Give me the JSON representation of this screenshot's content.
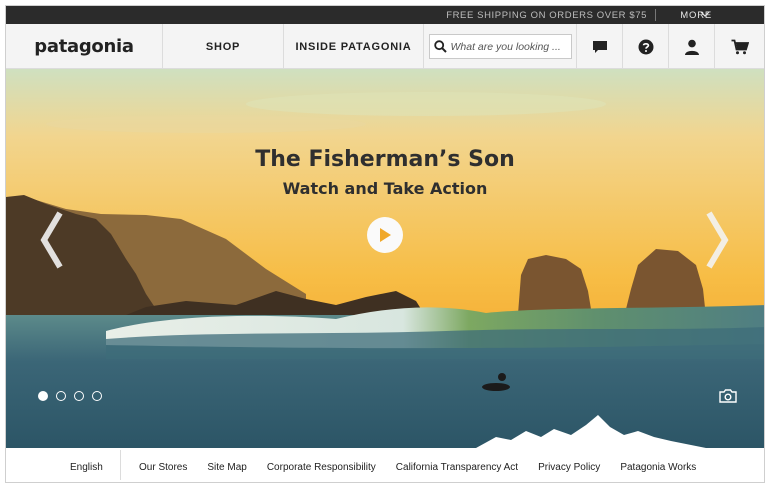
{
  "topbar": {
    "shipping_text": "FREE SHIPPING ON ORDERS OVER $75",
    "more_label": "MORE"
  },
  "nav": {
    "logo": "patagonia",
    "shop_label": "SHOP",
    "inside_label": "INSIDE PATAGONIA",
    "search_placeholder": "What are you looking ..."
  },
  "hero": {
    "title": "The Fisherman’s Son",
    "subtitle": "Watch and Take Action",
    "slide_count": 4,
    "active_slide": 1
  },
  "footer": {
    "language": "English",
    "links": [
      "Our Stores",
      "Site Map",
      "Corporate Responsibility",
      "California Transparency Act",
      "Privacy Policy",
      "Patagonia Works"
    ]
  },
  "icons": {
    "search": "search-icon",
    "chat": "chat-bubble-icon",
    "help": "question-mark-icon",
    "account": "user-icon",
    "cart": "shopping-cart-icon",
    "camera": "camera-icon"
  },
  "colors": {
    "topbar_bg": "#2b2b2b",
    "nav_bg": "#f4f4f4",
    "sky_top": "#cfe0c0",
    "sky_horizon": "#f7b93d",
    "ocean": "#3c6575"
  }
}
